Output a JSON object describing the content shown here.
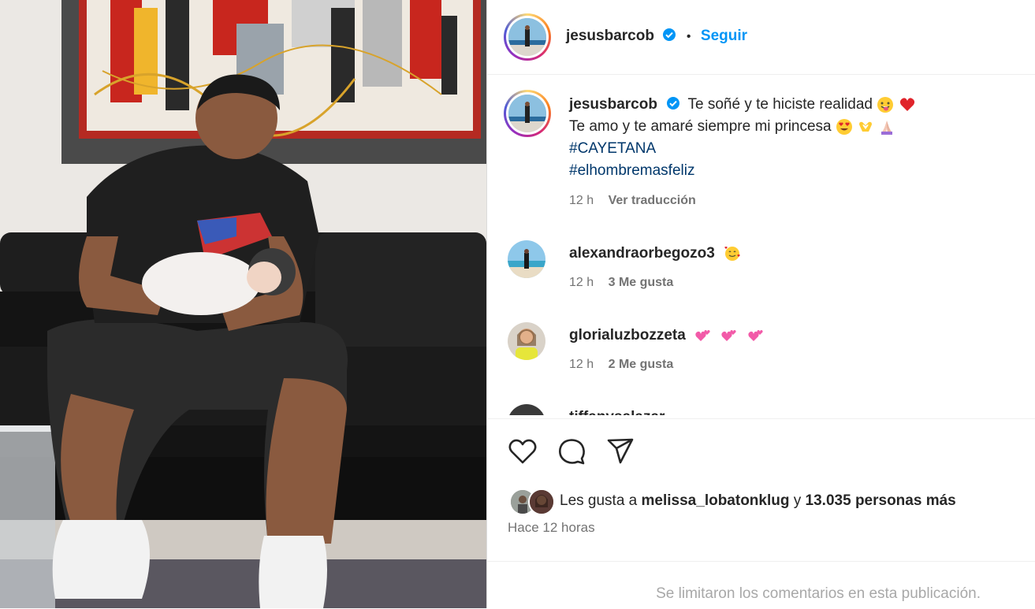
{
  "post": {
    "username": "jesusbarcob",
    "follow_label": "Seguir",
    "dot": "•",
    "caption": {
      "line1": "Te soñé y te hiciste realidad",
      "line2": "Te amo y te amaré siempre mi princesa",
      "hashtag1": "#CAYETANA",
      "hashtag2": "#elhombremasfeliz",
      "time": "12 h",
      "translate_label": "Ver traducción"
    },
    "comments": [
      {
        "username": "alexandraorbegozo3",
        "time": "12 h",
        "likes": "3 Me gusta"
      },
      {
        "username": "glorialuzbozzeta",
        "time": "12 h",
        "likes": "2 Me gusta"
      },
      {
        "username": "tiffanysalazar"
      }
    ],
    "likes": {
      "prefix": "Les gusta a",
      "user": "melissa_lobatonklug",
      "connector": "y",
      "count": "13.035 personas más"
    },
    "posted_time": "Hace 12 horas",
    "comments_limited": "Se limitaron los comentarios en esta publicación."
  },
  "colors": {
    "accent": "#0095f6",
    "verified": "#0095f6",
    "hashtag": "#00376b",
    "secondary_text": "#737373"
  },
  "icons": [
    "verified-badge-icon",
    "heart-icon",
    "comment-icon",
    "share-icon"
  ]
}
